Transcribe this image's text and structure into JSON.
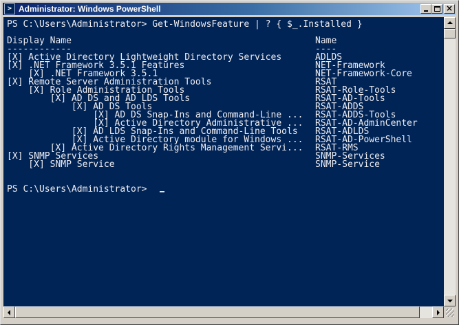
{
  "window": {
    "title": "Administrator: Windows PowerShell",
    "icon": "powershell-icon",
    "controls": {
      "minimize": "minimize-icon",
      "maximize": "maximize-icon",
      "close": "close-icon"
    }
  },
  "console": {
    "background": "#012456",
    "foreground": "#eeedf0",
    "command_line": "PS C:\\Users\\Administrator> Get-WindowsFeature | ? { $_.Installed }",
    "header": {
      "display_name": "Display Name",
      "name": "Name",
      "display_name_rule": "------------",
      "name_rule": "----"
    },
    "rows": [
      {
        "display": "[X] Active Directory Lightweight Directory Services",
        "name": "ADLDS"
      },
      {
        "display": "[X] .NET Framework 3.5.1 Features",
        "name": "NET-Framework"
      },
      {
        "display": "    [X] .NET Framework 3.5.1",
        "name": "NET-Framework-Core"
      },
      {
        "display": "[X] Remote Server Administration Tools",
        "name": "RSAT"
      },
      {
        "display": "    [X] Role Administration Tools",
        "name": "RSAT-Role-Tools"
      },
      {
        "display": "        [X] AD DS and AD LDS Tools",
        "name": "RSAT-AD-Tools"
      },
      {
        "display": "            [X] AD DS Tools",
        "name": "RSAT-ADDS"
      },
      {
        "display": "                [X] AD DS Snap-Ins and Command-Line ...",
        "name": "RSAT-ADDS-Tools"
      },
      {
        "display": "                [X] Active Directory Administrative ...",
        "name": "RSAT-AD-AdminCenter"
      },
      {
        "display": "            [X] AD LDS Snap-Ins and Command-Line Tools",
        "name": "RSAT-ADLDS"
      },
      {
        "display": "            [X] Active Directory module for Windows ...",
        "name": "RSAT-AD-PowerShell"
      },
      {
        "display": "        [X] Active Directory Rights Management Servi...",
        "name": "RSAT-RMS"
      },
      {
        "display": "[X] SNMP Services",
        "name": "SNMP-Services"
      },
      {
        "display": "    [X] SNMP Service",
        "name": "SNMP-Service"
      }
    ],
    "prompt": "PS C:\\Users\\Administrator>"
  }
}
